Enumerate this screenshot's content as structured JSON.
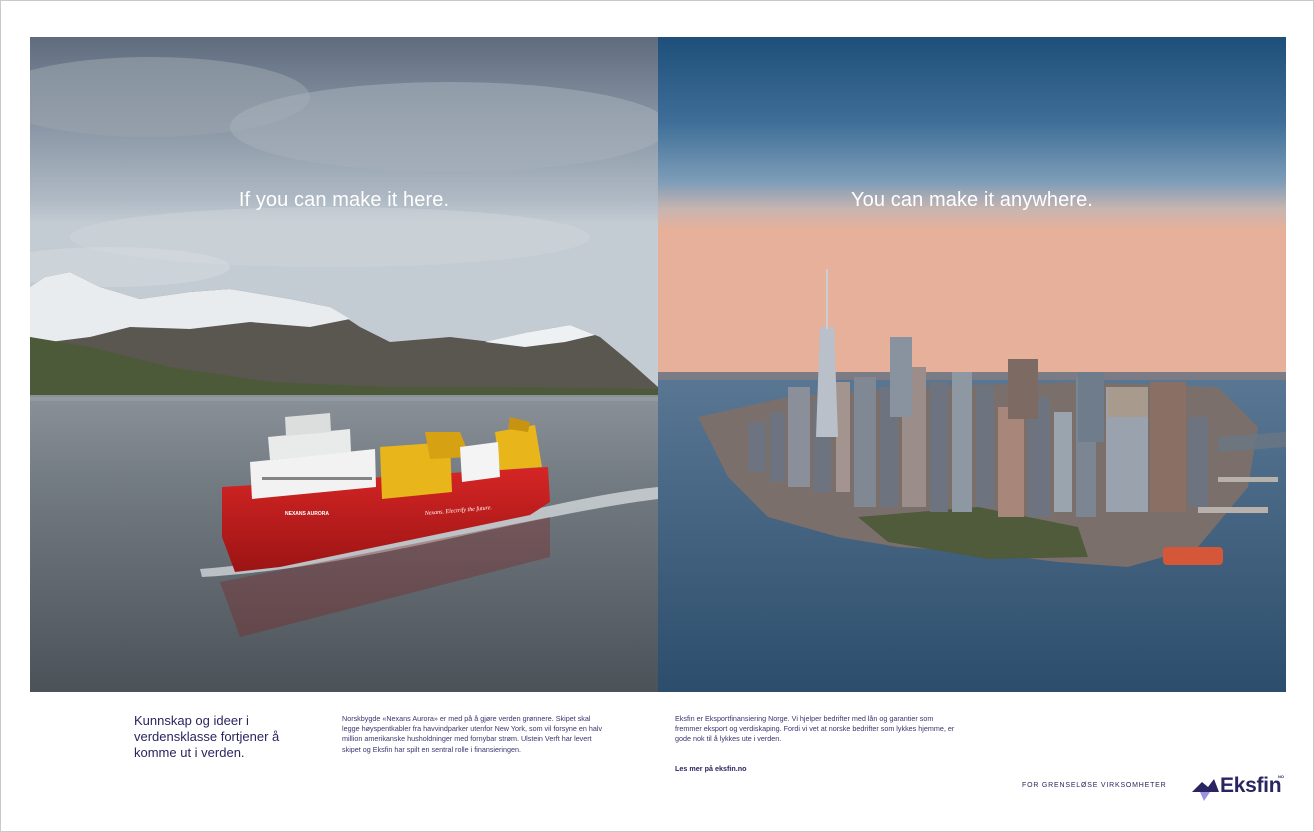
{
  "ad": {
    "left_headline": "If you can make it here.",
    "right_headline": "You can make it anywhere.",
    "intro_text": "Kunnskap og ideer i verdensklasse fortjener å komme ut i verden.",
    "body_col1": "Norskbygde «Nexans Aurora» er med på å gjøre verden grønnere. Skipet skal legge høyspentkabler fra havvindparker utenfor New York, som vil forsyne en halv million amerikanske husholdninger med fornybar strøm. Ulstein Verft har levert skipet og Eksfin har spilt en sentral rolle i finansieringen.",
    "body_col2": "Eksfin er Eksportfinansiering Norge. Vi hjelper bedrifter med lån og garantier som fremmer eksport og verdiskaping. Fordi vi vet at norske bedrifter som lykkes hjemme, er gode nok til å lykkes ute i verden.",
    "link_text": "Les mer på eksfin.no",
    "tagline": "FOR GRENSELØSE VIRKSOMHETER",
    "logo_text": "Eksfin",
    "logo_sup": "NO",
    "ship_name": "NEXANS AURORA",
    "ship_slogan": "Nexans. Electrify the future."
  },
  "colors": {
    "brand_navy": "#2a2560",
    "ship_red": "#cc1f1f",
    "crane_yellow": "#e8b51a"
  }
}
